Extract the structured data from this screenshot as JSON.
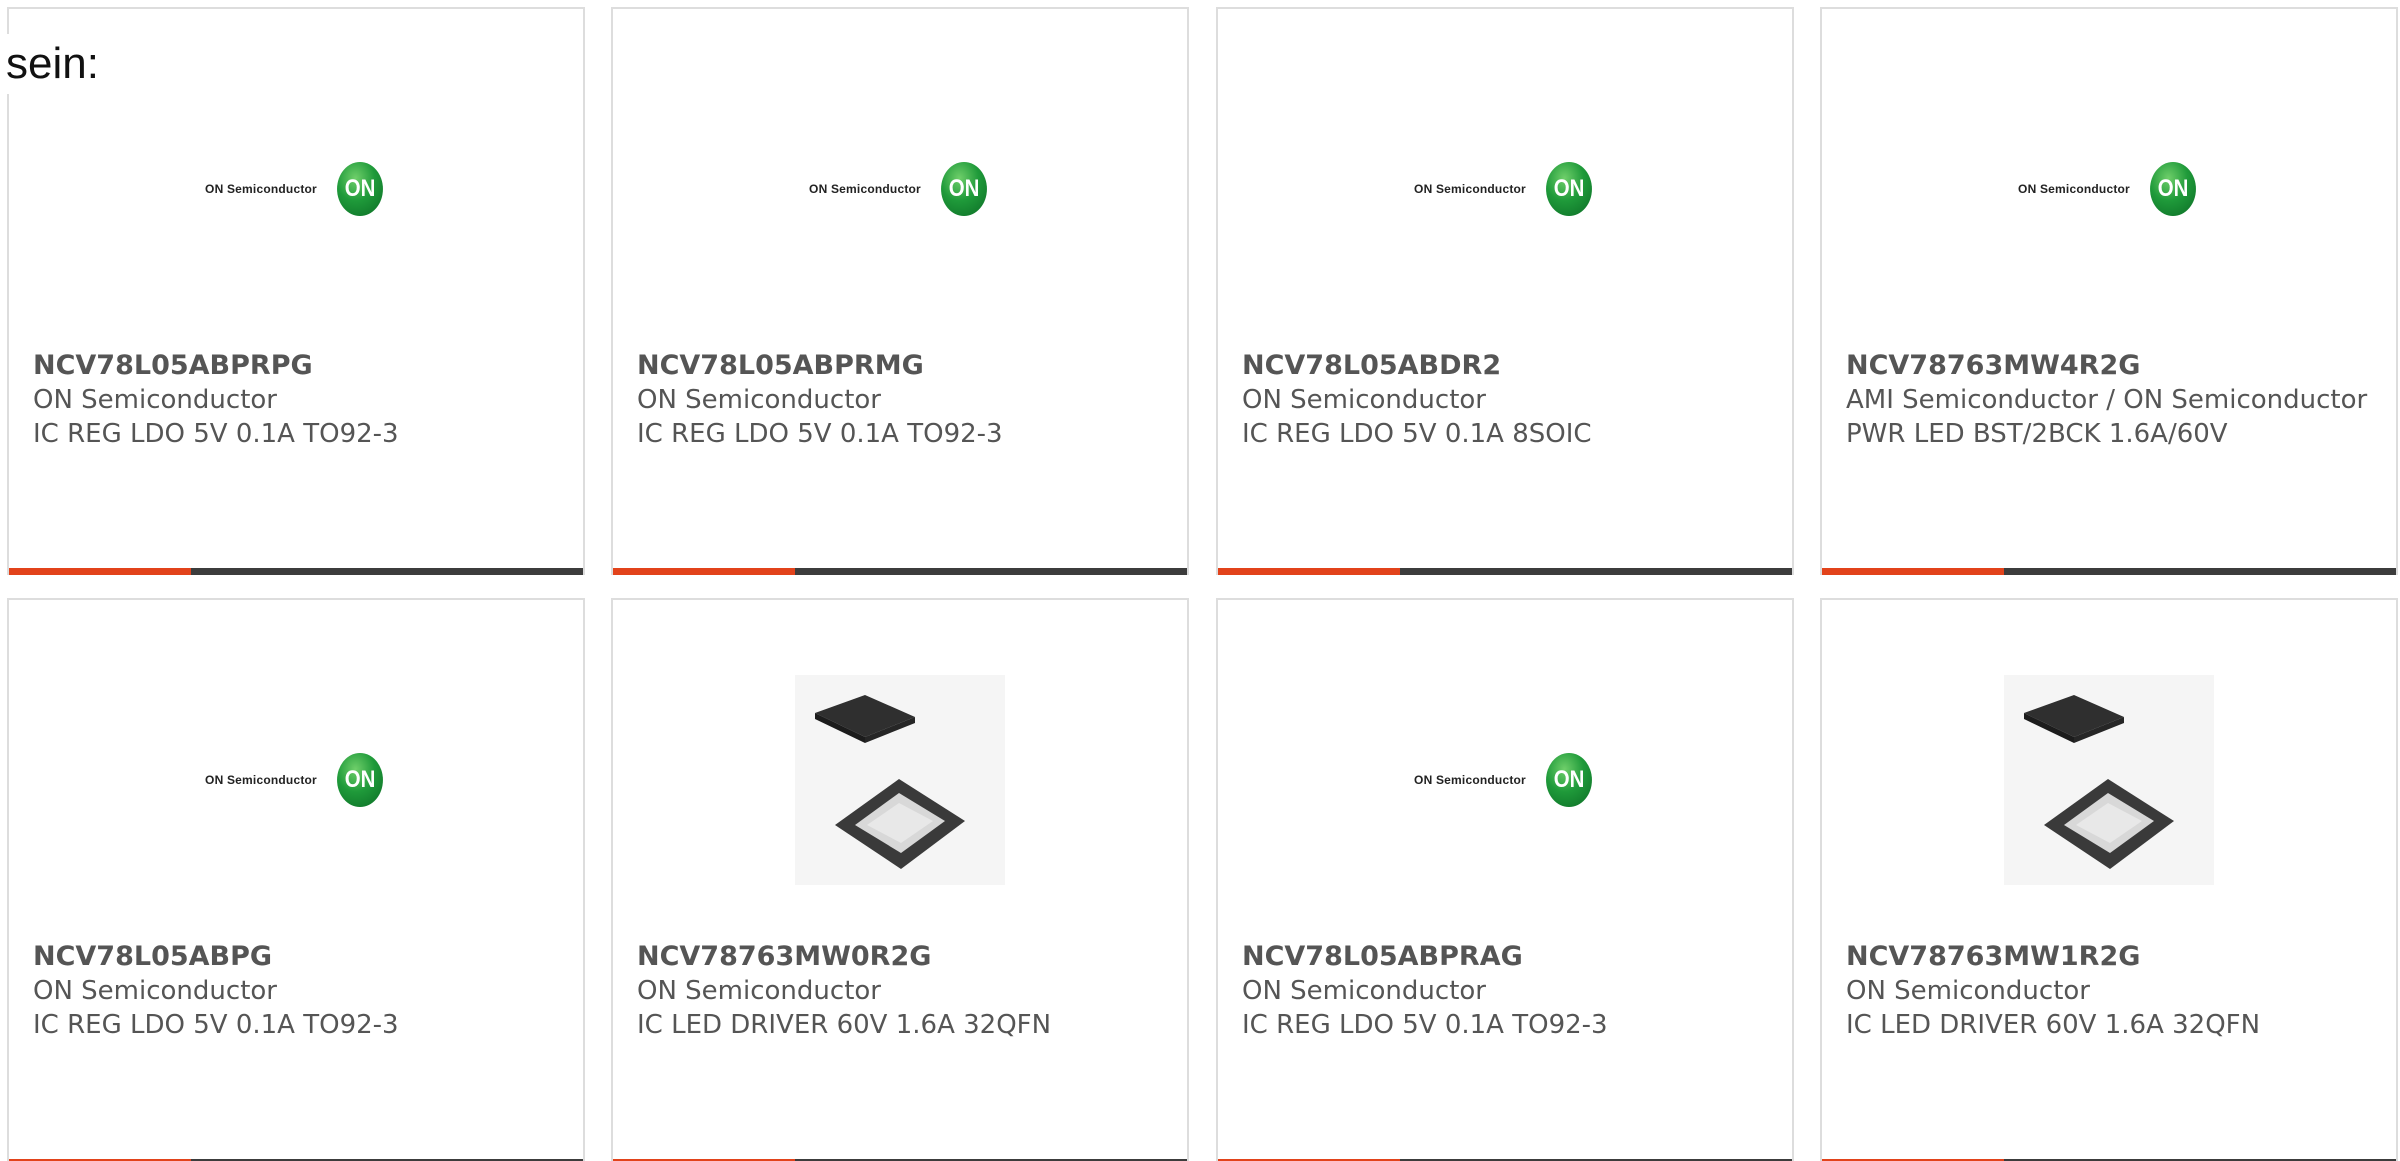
{
  "intro": {
    "text": "sein:"
  },
  "logo": {
    "wordmark": "ON Semiconductor",
    "badge": "ON"
  },
  "colors": {
    "accent": "#e2431b",
    "bar": "#3c3c3c",
    "border": "#dddddd",
    "text": "#555555"
  },
  "products": [
    {
      "part": "NCV78L05ABPRPG",
      "manufacturer": "ON Semiconductor",
      "description": "IC REG LDO 5V 0.1A TO92-3",
      "image": "on-semiconductor-logo"
    },
    {
      "part": "NCV78L05ABPRMG",
      "manufacturer": "ON Semiconductor",
      "description": "IC REG LDO 5V 0.1A TO92-3",
      "image": "on-semiconductor-logo"
    },
    {
      "part": "NCV78L05ABDR2",
      "manufacturer": "ON Semiconductor",
      "description": "IC REG LDO 5V 0.1A 8SOIC",
      "image": "on-semiconductor-logo"
    },
    {
      "part": "NCV78763MW4R2G",
      "manufacturer": "AMI Semiconductor / ON Semiconductor",
      "description": "PWR LED BST/2BCK 1.6A/60V",
      "image": "on-semiconductor-logo"
    },
    {
      "part": "NCV78L05ABPG",
      "manufacturer": "ON Semiconductor",
      "description": "IC REG LDO 5V 0.1A TO92-3",
      "image": "on-semiconductor-logo"
    },
    {
      "part": "NCV78763MW0R2G",
      "manufacturer": "ON Semiconductor",
      "description": "IC LED DRIVER 60V 1.6A 32QFN",
      "image": "qfn-chip-photo"
    },
    {
      "part": "NCV78L05ABPRAG",
      "manufacturer": "ON Semiconductor",
      "description": "IC REG LDO 5V 0.1A TO92-3",
      "image": "on-semiconductor-logo"
    },
    {
      "part": "NCV78763MW1R2G",
      "manufacturer": "ON Semiconductor",
      "description": "IC LED DRIVER 60V 1.6A 32QFN",
      "image": "qfn-chip-photo"
    }
  ]
}
